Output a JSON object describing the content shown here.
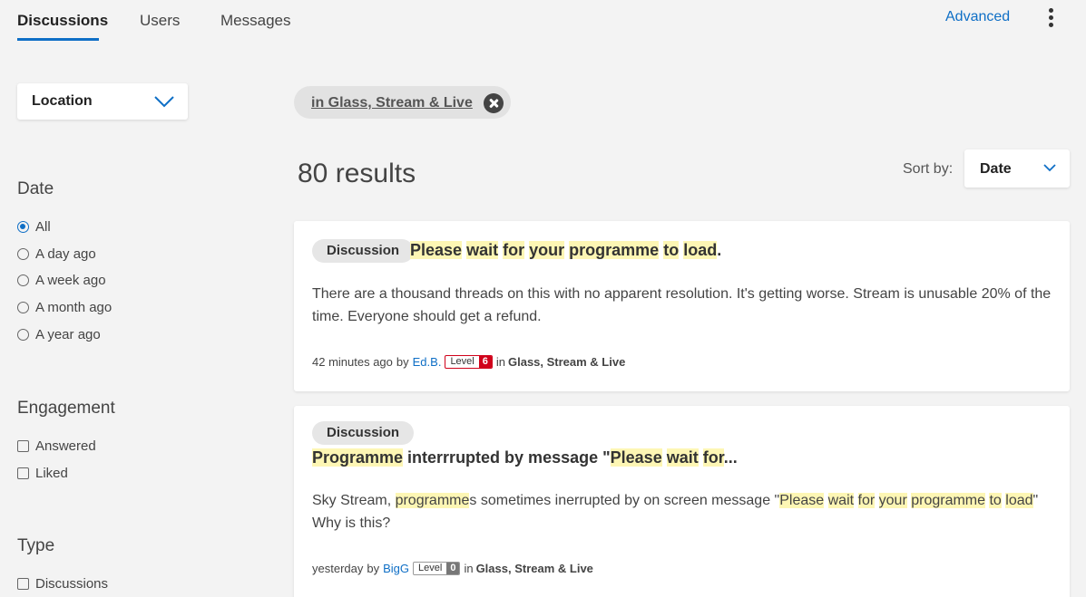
{
  "tabs": [
    {
      "label": "Discussions",
      "active": true
    },
    {
      "label": "Users",
      "active": false
    },
    {
      "label": "Messages",
      "active": false
    }
  ],
  "header": {
    "advanced_label": "Advanced",
    "more_icon": "kebab-menu-icon"
  },
  "sidebar": {
    "location": {
      "label": "Location",
      "icon": "chevron-down-icon"
    },
    "date": {
      "title": "Date",
      "options": [
        "All",
        "A day ago",
        "A week ago",
        "A month ago",
        "A year ago"
      ],
      "selected": "All"
    },
    "engagement": {
      "title": "Engagement",
      "options": [
        "Answered",
        "Liked"
      ]
    },
    "type": {
      "title": "Type",
      "options": [
        "Discussions"
      ]
    }
  },
  "filter_chip": {
    "label": "in Glass, Stream & Live",
    "close_icon": "close-circle-icon"
  },
  "results": {
    "count_text": "80 results"
  },
  "sort": {
    "label": "Sort by:",
    "value": "Date"
  },
  "colors": {
    "accent": "#0f6fc6",
    "highlight": "#fdf6b4",
    "level_red": "#d0021b"
  },
  "cards": [
    {
      "badge": "Discussion",
      "title_parts": [
        {
          "t": "Please",
          "hl": true
        },
        {
          "t": " ",
          "hl": false
        },
        {
          "t": "wait",
          "hl": true
        },
        {
          "t": " ",
          "hl": false
        },
        {
          "t": "for",
          "hl": true
        },
        {
          "t": " ",
          "hl": false
        },
        {
          "t": "your",
          "hl": true
        },
        {
          "t": " ",
          "hl": false
        },
        {
          "t": "programme",
          "hl": true
        },
        {
          "t": " ",
          "hl": false
        },
        {
          "t": "to",
          "hl": true
        },
        {
          "t": " ",
          "hl": false
        },
        {
          "t": "load",
          "hl": true
        },
        {
          "t": ".",
          "hl": false
        }
      ],
      "body_parts": [
        {
          "t": "There are a thousand threads on this with no apparent resolution.   It's getting worse.   Stream is unusable 20% of the time.   Everyone should get a refund.",
          "hl": false
        }
      ],
      "time": "42 minutes ago",
      "by": "by",
      "author": "Ed.B.",
      "level_label": "Level",
      "level": "6",
      "in_label": "in",
      "location": "Glass, Stream & Live"
    },
    {
      "badge": "Discussion",
      "title_parts": [
        {
          "t": "Programme",
          "hl": true
        },
        {
          "t": " interrrupted by message \"",
          "hl": false
        },
        {
          "t": "Please",
          "hl": true
        },
        {
          "t": " ",
          "hl": false
        },
        {
          "t": "wait",
          "hl": true
        },
        {
          "t": " ",
          "hl": false
        },
        {
          "t": "for",
          "hl": true
        },
        {
          "t": "...",
          "hl": false
        }
      ],
      "body_parts": [
        {
          "t": "Sky Stream, ",
          "hl": false
        },
        {
          "t": "programme",
          "hl": true
        },
        {
          "t": "s sometimes inerrupted by on screen message \"",
          "hl": false
        },
        {
          "t": "Please",
          "hl": true
        },
        {
          "t": " ",
          "hl": false
        },
        {
          "t": "wait",
          "hl": true
        },
        {
          "t": " ",
          "hl": false
        },
        {
          "t": "for",
          "hl": true
        },
        {
          "t": " ",
          "hl": false
        },
        {
          "t": "your",
          "hl": true
        },
        {
          "t": " ",
          "hl": false
        },
        {
          "t": "programme",
          "hl": true
        },
        {
          "t": " ",
          "hl": false
        },
        {
          "t": "to",
          "hl": true
        },
        {
          "t": " ",
          "hl": false
        },
        {
          "t": "load",
          "hl": true
        },
        {
          "t": "\"   Why is this?",
          "hl": false
        }
      ],
      "time": "yesterday",
      "by": "by",
      "author": "BigG",
      "level_label": "Level",
      "level": "0",
      "in_label": "in",
      "location": "Glass, Stream & Live"
    }
  ]
}
